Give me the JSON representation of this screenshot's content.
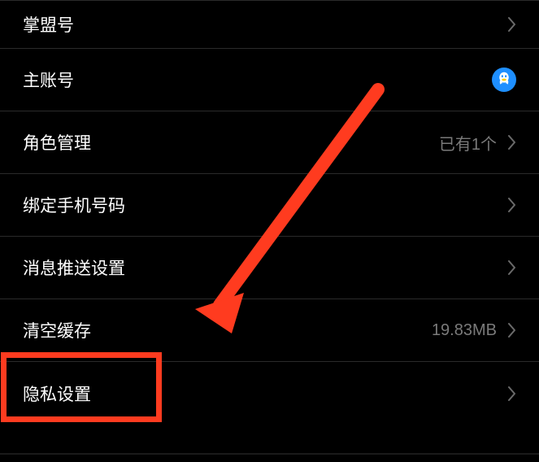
{
  "settings": {
    "items": [
      {
        "label": "掌盟号",
        "value": "",
        "icon": null
      },
      {
        "label": "主账号",
        "value": "",
        "icon": "qq"
      },
      {
        "label": "角色管理",
        "value": "已有1个",
        "icon": null
      },
      {
        "label": "绑定手机号码",
        "value": "",
        "icon": null
      },
      {
        "label": "消息推送设置",
        "value": "",
        "icon": null
      },
      {
        "label": "清空缓存",
        "value": "19.83MB",
        "icon": null
      },
      {
        "label": "隐私设置",
        "value": "",
        "icon": null
      }
    ]
  },
  "annotation": {
    "highlighted_item_index": 6,
    "arrow_target": "隐私设置"
  }
}
